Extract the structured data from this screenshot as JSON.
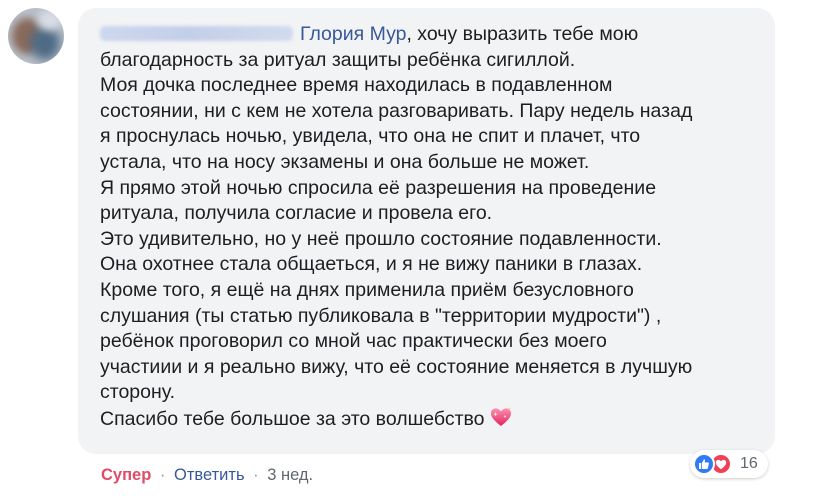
{
  "comment": {
    "mention": "Глория Мур",
    "lines": [
      ", хочу выразить тебе мою",
      "благодарность за ритуал защиты ребёнка сигиллой.",
      "Моя дочка последнее время находилась в подавленном",
      "состоянии, ни с кем не хотела разговаривать. Пару недель назад",
      "я проснулась ночью, увидела, что она не спит и плачет, что",
      "устала, что на носу экзамены и она больше не может.",
      "Я прямо этой ночью спросила её разрешения на проведение",
      "ритуала, получила согласие и провела его.",
      "Это удивительно, но у неё прошло состояние подавленности.",
      "Она охотнее стала общаеться, и я не вижу паники в глазах.",
      "Кроме того, я ещё на днях применила приём безусловного",
      "слушания (ты статью публиковала в \"территории мудрости\") ,",
      "ребёнок проговорил со мной час практически без моего",
      "участиии и я реально вижу, что её состояние меняется в лучшую",
      "сторону.",
      "Спасибо тебе большое за это волшебство"
    ],
    "end_emoji": "sparkling-heart-icon"
  },
  "actions": {
    "reaction_label": "Супер",
    "reply_label": "Ответить",
    "separator": "·",
    "time": "3 нед."
  },
  "reactions": {
    "icons": [
      "like-icon",
      "love-icon"
    ],
    "count": "16"
  },
  "colors": {
    "bubble": "#f2f3f5",
    "text": "#1c1e21",
    "link": "#385898",
    "super_reaction": "#e04c66",
    "like": "#2f7cf6",
    "love": "#f33e58",
    "meta": "#606770"
  }
}
